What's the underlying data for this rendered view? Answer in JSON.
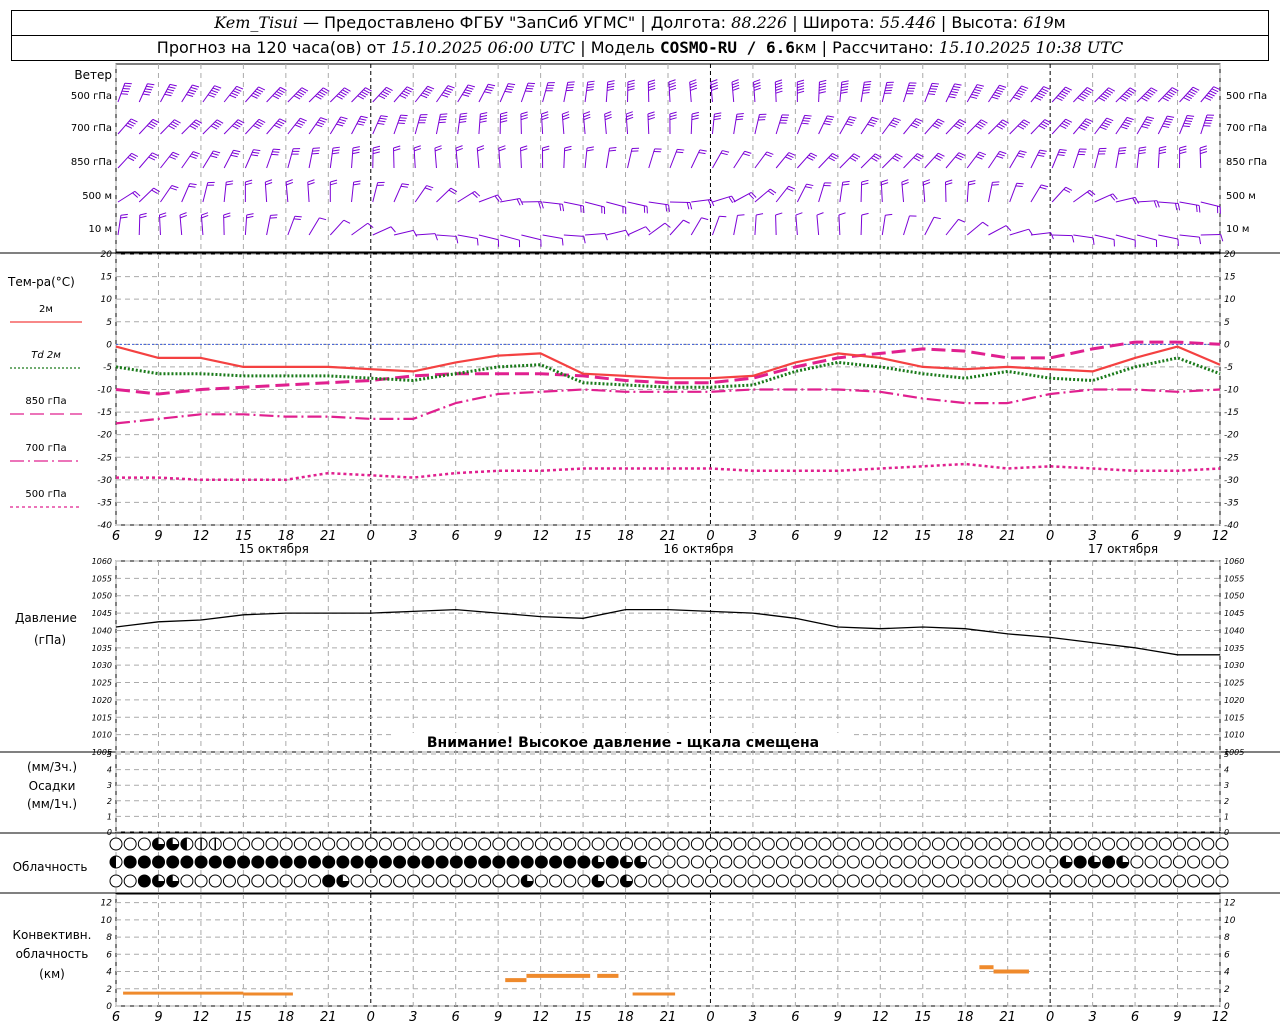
{
  "header": {
    "station": "Kem_Tisui",
    "provider": "— Предоставлено ФГБУ \"ЗапСиб УГМС\" | Долгота:",
    "lon": "88.226",
    "lat_label": "| Широта:",
    "lat": "55.446",
    "alt_label": "| Высота:",
    "alt": "619",
    "alt_unit": "м",
    "forecast_label": "Прогноз на 120 часа(ов) от",
    "issued": "15.10.2025 06:00 UTC",
    "model_label": "| Модель",
    "model": "COSMO-RU / 6.6",
    "model_unit": "км | Рассчитано:",
    "computed": "15.10.2025 10:38 UTC"
  },
  "wind_panel": {
    "title": "Ветер",
    "levels": [
      "500 гПа",
      "700 гПа",
      "850 гПа",
      "500 м",
      "10  м"
    ],
    "barb_color": "#7b00d6"
  },
  "temp_panel": {
    "title": "Тем-ра(°С)",
    "legend": [
      {
        "label": "2м",
        "color": "#f44141"
      },
      {
        "label": "Td 2м",
        "color": "#1a7a1a"
      },
      {
        "label": "850 гПа",
        "color": "#e0208f"
      },
      {
        "label": "700 гПа",
        "color": "#e0208f"
      },
      {
        "label": "500 гПа",
        "color": "#e0208f"
      }
    ]
  },
  "pressure_panel": {
    "title1": "Давление",
    "title2": "(гПа)",
    "warning": "Внимание! Высокое давление - щкала смещена"
  },
  "precip_panel": {
    "title1": "(мм/3ч.)",
    "title2": "Осадки",
    "title3": "(мм/1ч.)"
  },
  "cloud_panel": {
    "title": "Облачность"
  },
  "conv_panel": {
    "title1": "Конвективн.",
    "title2": "облачность",
    "title3": "(км)"
  },
  "time_axis": {
    "hours": [
      "6",
      "9",
      "12",
      "15",
      "18",
      "21",
      "0",
      "3",
      "6",
      "9",
      "12",
      "15",
      "18",
      "21",
      "0",
      "3",
      "6",
      "9",
      "12",
      "15",
      "18",
      "21",
      "0",
      "3",
      "6",
      "9",
      "12"
    ],
    "dates": [
      "15 октября",
      "16 октября",
      "17 октября"
    ]
  },
  "chart_data": [
    {
      "type": "line",
      "title": "Тем-ра(°С)",
      "x_hours_from_start": [
        0,
        3,
        6,
        9,
        12,
        15,
        18,
        21,
        24,
        27,
        30,
        33,
        36,
        39,
        42,
        45,
        48,
        51,
        54,
        57,
        60,
        63,
        66,
        69,
        72,
        75,
        78
      ],
      "ylim": [
        -40,
        20
      ],
      "yticks": [
        20,
        15,
        10,
        5,
        0,
        -5,
        -10,
        -15,
        -20,
        -25,
        -30,
        -35,
        -40
      ],
      "series": [
        {
          "name": "2м",
          "color": "#f44141",
          "values": [
            -0.5,
            -3,
            -3,
            -5,
            -5,
            -5,
            -5.5,
            -6,
            -4,
            -2.5,
            -2,
            -6.5,
            -7,
            -7.5,
            -7.5,
            -7,
            -4,
            -2,
            -3,
            -5,
            -5.5,
            -5,
            -5.5,
            -6,
            -3,
            -0.5,
            -4.5
          ]
        },
        {
          "name": "Td 2м",
          "color": "#1a7a1a",
          "values": [
            -5,
            -6.5,
            -6.5,
            -7,
            -7,
            -7,
            -7.5,
            -8,
            -6.5,
            -5,
            -4.5,
            -8.5,
            -9,
            -9.5,
            -9.5,
            -9,
            -6,
            -4,
            -5,
            -6.5,
            -7.5,
            -6,
            -7.5,
            -8,
            -5,
            -3,
            -6.5
          ]
        },
        {
          "name": "850 гПа",
          "color": "#e0208f",
          "values": [
            -10,
            -11,
            -10,
            -9.5,
            -9,
            -8.5,
            -8,
            -7,
            -6.5,
            -6.5,
            -6.5,
            -7,
            -8,
            -8.5,
            -8.5,
            -7.5,
            -5,
            -3,
            -2,
            -1,
            -1.5,
            -3,
            -3,
            -1,
            0.5,
            0.5,
            0
          ]
        },
        {
          "name": "700 гПа",
          "color": "#e0208f",
          "values": [
            -17.5,
            -16.5,
            -15.5,
            -15.5,
            -16,
            -16,
            -16.5,
            -16.5,
            -13,
            -11,
            -10.5,
            -10,
            -10.5,
            -10.5,
            -10.5,
            -10,
            -10,
            -10,
            -10.5,
            -12,
            -13,
            -13,
            -11,
            -10,
            -10,
            -10.5,
            -10
          ]
        },
        {
          "name": "500 гПа",
          "color": "#e0208f",
          "values": [
            -29.5,
            -29.5,
            -30,
            -30,
            -30,
            -28.5,
            -29,
            -29.5,
            -28.5,
            -28,
            -28,
            -27.5,
            -27.5,
            -27.5,
            -27.5,
            -28,
            -28,
            -28,
            -27.5,
            -27,
            -26.5,
            -27.5,
            -27,
            -27.5,
            -28,
            -28,
            -27.5
          ]
        }
      ]
    },
    {
      "type": "line",
      "title": "Давление",
      "x_hours_from_start": [
        0,
        3,
        6,
        9,
        12,
        15,
        18,
        21,
        24,
        27,
        30,
        33,
        36,
        39,
        42,
        45,
        48,
        51,
        54,
        57,
        60,
        63,
        66,
        69,
        72,
        75,
        78
      ],
      "ylim": [
        1005,
        1060
      ],
      "yticks": [
        1060,
        1055,
        1050,
        1045,
        1040,
        1035,
        1030,
        1025,
        1020,
        1015,
        1010,
        1005
      ],
      "series": [
        {
          "name": "Давление",
          "color": "#000000",
          "values": [
            1041,
            1042.5,
            1043,
            1044.5,
            1045,
            1045,
            1045,
            1045.5,
            1046,
            1045,
            1044,
            1043.5,
            1046,
            1046,
            1045.5,
            1045,
            1043.5,
            1041,
            1040.5,
            1041,
            1040.5,
            1039,
            1038,
            1036.5,
            1035,
            1033,
            1033
          ]
        }
      ]
    },
    {
      "type": "bar",
      "title": "Осадки",
      "ylim": [
        0,
        5
      ],
      "yticks": [
        5,
        4,
        3,
        2,
        1,
        0
      ],
      "series": [
        {
          "name": "Осадки",
          "values": []
        }
      ]
    },
    {
      "type": "bar",
      "title": "Конвективн. облачность",
      "ylim": [
        0,
        13
      ],
      "yticks": [
        12,
        10,
        8,
        6,
        4,
        2,
        0
      ],
      "segments": [
        {
          "x_start": 0.5,
          "x_end": 9,
          "y": 1.5
        },
        {
          "x_start": 9,
          "x_end": 12.5,
          "y": 1.4
        },
        {
          "x_start": 27.5,
          "x_end": 29,
          "y": 3
        },
        {
          "x_start": 29,
          "x_end": 33.5,
          "y": 3.5
        },
        {
          "x_start": 34,
          "x_end": 35.5,
          "y": 3.5
        },
        {
          "x_start": 36.5,
          "x_end": 39.5,
          "y": 1.4
        },
        {
          "x_start": 61,
          "x_end": 62,
          "y": 4.5
        },
        {
          "x_start": 62,
          "x_end": 64.5,
          "y": 4
        }
      ],
      "color": "#ef8a2c"
    }
  ]
}
